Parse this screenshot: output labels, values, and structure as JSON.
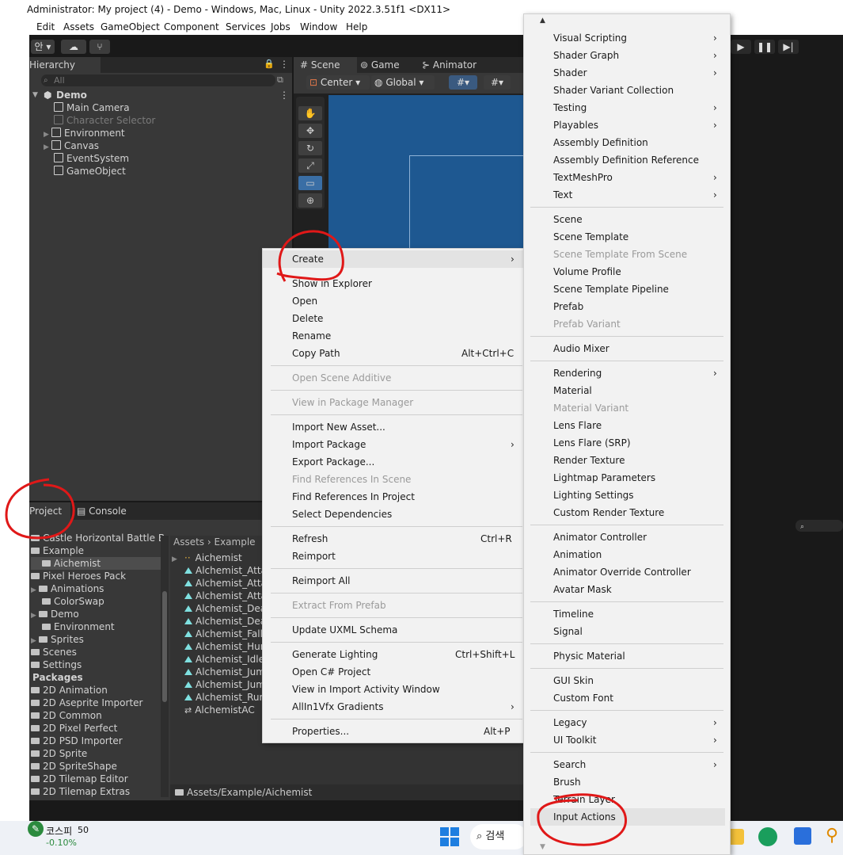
{
  "window": {
    "title": "Administrator: My project (4) - Demo - Windows, Mac, Linux - Unity 2022.3.51f1 <DX11>"
  },
  "menubar": [
    "Edit",
    "Assets",
    "GameObject",
    "Component",
    "Services",
    "Jobs",
    "Window",
    "Help"
  ],
  "toolbar": {
    "account_label": "안 ▾",
    "play_icons": [
      "play-icon",
      "pause-icon",
      "step-icon"
    ]
  },
  "hierarchy": {
    "tab_label": "Hierarchy",
    "search_placeholder": "All",
    "scene_name": "Demo",
    "items": [
      "Main Camera",
      "Character Selector",
      "Environment",
      "Canvas",
      "EventSystem",
      "GameObject"
    ]
  },
  "scene": {
    "tabs": [
      "Scene",
      "Game",
      "Animator"
    ],
    "pivot_label": "Center",
    "space_label": "Global"
  },
  "project": {
    "tabs": [
      "Project",
      "Console"
    ],
    "tree": [
      "Castle Horizontal Battle B",
      "Example",
      "Aichemist",
      "Pixel Heroes Pack",
      "Animations",
      "ColorSwap",
      "Demo",
      "Environment",
      "Sprites",
      "Scenes",
      "Settings",
      "Packages",
      "2D Animation",
      "2D Aseprite Importer",
      "2D Common",
      "2D Pixel Perfect",
      "2D PSD Importer",
      "2D Sprite",
      "2D SpriteShape",
      "2D Tilemap Editor",
      "2D Tilemap Extras"
    ],
    "breadcrumb": [
      "Assets",
      "Example"
    ],
    "assets": [
      "Aichemist",
      "Alchemist_Atta",
      "Alchemist_Atta",
      "Alchemist_Atta",
      "Alchemist_Dea",
      "Alchemist_Dea",
      "Alchemist_Fall",
      "Alchemist_Hur",
      "Alchemist_Idle",
      "Alchemist_Jum",
      "Alchemist_Jum",
      "Alchemist_Run",
      "AlchemistAC"
    ],
    "path": "Assets/Example/Aichemist"
  },
  "context_menu": [
    {
      "label": "Create",
      "submenu": true,
      "shortcut": ""
    },
    {
      "label": "Show in Explorer",
      "shortcut": ""
    },
    {
      "label": "Open",
      "shortcut": ""
    },
    {
      "label": "Delete",
      "shortcut": ""
    },
    {
      "label": "Rename",
      "shortcut": ""
    },
    {
      "label": "Copy Path",
      "shortcut": "Alt+Ctrl+C"
    },
    {
      "label": "Open Scene Additive",
      "disabled": true,
      "shortcut": ""
    },
    {
      "label": "View in Package Manager",
      "disabled": true,
      "shortcut": ""
    },
    {
      "label": "Import New Asset...",
      "shortcut": ""
    },
    {
      "label": "Import Package",
      "submenu": true,
      "shortcut": ""
    },
    {
      "label": "Export Package...",
      "shortcut": ""
    },
    {
      "label": "Find References In Scene",
      "disabled": true,
      "shortcut": ""
    },
    {
      "label": "Find References In Project",
      "shortcut": ""
    },
    {
      "label": "Select Dependencies",
      "shortcut": ""
    },
    {
      "label": "Refresh",
      "shortcut": "Ctrl+R"
    },
    {
      "label": "Reimport",
      "shortcut": ""
    },
    {
      "label": "Reimport All",
      "shortcut": ""
    },
    {
      "label": "Extract From Prefab",
      "disabled": true,
      "shortcut": ""
    },
    {
      "label": "Update UXML Schema",
      "shortcut": ""
    },
    {
      "label": "Generate Lighting",
      "shortcut": "Ctrl+Shift+L"
    },
    {
      "label": "Open C# Project",
      "shortcut": ""
    },
    {
      "label": "View in Import Activity Window",
      "shortcut": ""
    },
    {
      "label": "AllIn1Vfx Gradients",
      "submenu": true,
      "shortcut": ""
    },
    {
      "label": "Properties...",
      "shortcut": "Alt+P"
    }
  ],
  "create_submenu": [
    {
      "label": "Visual Scripting",
      "submenu": true
    },
    {
      "label": "Shader Graph",
      "submenu": true
    },
    {
      "label": "Shader",
      "submenu": true
    },
    {
      "label": "Shader Variant Collection"
    },
    {
      "label": "Testing",
      "submenu": true
    },
    {
      "label": "Playables",
      "submenu": true
    },
    {
      "label": "Assembly Definition"
    },
    {
      "label": "Assembly Definition Reference"
    },
    {
      "label": "TextMeshPro",
      "submenu": true
    },
    {
      "label": "Text",
      "submenu": true
    },
    {
      "label": "Scene"
    },
    {
      "label": "Scene Template"
    },
    {
      "label": "Scene Template From Scene",
      "disabled": true
    },
    {
      "label": "Volume Profile"
    },
    {
      "label": "Scene Template Pipeline"
    },
    {
      "label": "Prefab"
    },
    {
      "label": "Prefab Variant",
      "disabled": true
    },
    {
      "label": "Audio Mixer"
    },
    {
      "label": "Rendering",
      "submenu": true
    },
    {
      "label": "Material"
    },
    {
      "label": "Material Variant",
      "disabled": true
    },
    {
      "label": "Lens Flare"
    },
    {
      "label": "Lens Flare (SRP)"
    },
    {
      "label": "Render Texture"
    },
    {
      "label": "Lightmap Parameters"
    },
    {
      "label": "Lighting Settings"
    },
    {
      "label": "Custom Render Texture"
    },
    {
      "label": "Animator Controller"
    },
    {
      "label": "Animation"
    },
    {
      "label": "Animator Override Controller"
    },
    {
      "label": "Avatar Mask"
    },
    {
      "label": "Timeline"
    },
    {
      "label": "Signal"
    },
    {
      "label": "Physic Material"
    },
    {
      "label": "GUI Skin"
    },
    {
      "label": "Custom Font"
    },
    {
      "label": "Legacy",
      "submenu": true
    },
    {
      "label": "UI Toolkit",
      "submenu": true
    },
    {
      "label": "Search",
      "submenu": true
    },
    {
      "label": "Brush"
    },
    {
      "label": "Terrain Layer"
    },
    {
      "label": "Input Actions"
    }
  ],
  "taskbar": {
    "stock_name": "코스피",
    "stock_value": "50",
    "stock_change": "-0.10%",
    "search_label": "검색"
  }
}
